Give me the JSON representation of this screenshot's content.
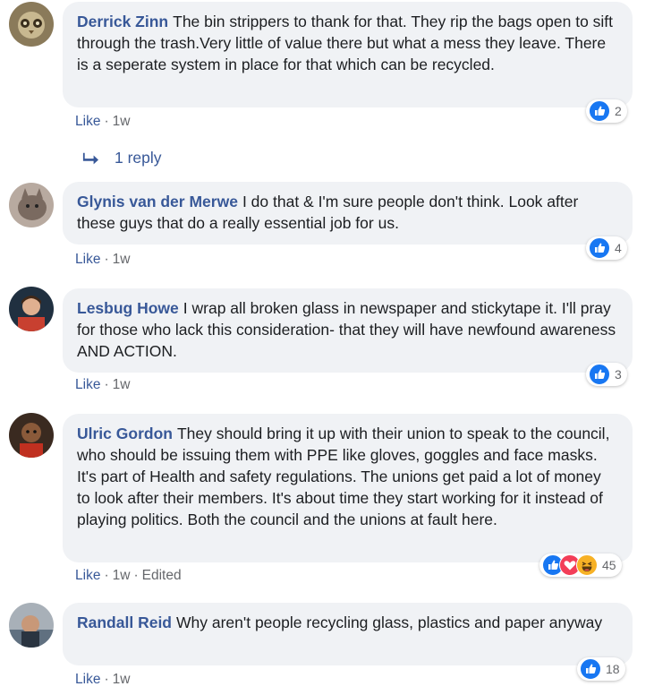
{
  "colors": {
    "link": "#385898",
    "bubble": "#f0f2f5",
    "meta": "#65676b",
    "like": "#1877f2",
    "love": "#f33e58",
    "haha": "#f7b125"
  },
  "comments": [
    {
      "author": "Derrick Zinn",
      "text": "The bin strippers to thank for that. They rip the bags open to sift through the trash.Very little of value there but what a mess they leave. There is a seperate system in place for that which can be recycled.",
      "like_label": "Like",
      "time": "1w",
      "edited": "",
      "reaction_icons": [
        "like-icon"
      ],
      "reaction_count": "2",
      "replies_label": "1 reply"
    },
    {
      "author": "Glynis van der Merwe",
      "text": "I do that & I'm sure people don't think. Look after these guys that do a really essential job for us.",
      "like_label": "Like",
      "time": "1w",
      "edited": "",
      "reaction_icons": [
        "like-icon"
      ],
      "reaction_count": "4"
    },
    {
      "author": "Lesbug Howe",
      "text": "I wrap all broken glass in newspaper and stickytape it. I'll pray for those who lack this consideration- that they will have newfound awareness AND ACTION.",
      "like_label": "Like",
      "time": "1w",
      "edited": "",
      "reaction_icons": [
        "like-icon"
      ],
      "reaction_count": "3"
    },
    {
      "author": "Ulric Gordon",
      "text": "They should bring it up with their union to speak to the council, who should be issuing them with PPE like gloves, goggles and face masks. It's part of Health and safety regulations. The unions get paid a lot of money to look after their members. It's about time they start working for it instead of playing politics. Both the council and the unions at fault here.",
      "like_label": "Like",
      "time": "1w",
      "edited": "Edited",
      "reaction_icons": [
        "like-icon",
        "love-icon",
        "haha-icon"
      ],
      "reaction_count": "45"
    },
    {
      "author": "Randall Reid",
      "text": "Why aren't people recycling glass, plastics and paper anyway",
      "like_label": "Like",
      "time": "1w",
      "edited": "",
      "reaction_icons": [
        "like-icon"
      ],
      "reaction_count": "18"
    }
  ]
}
